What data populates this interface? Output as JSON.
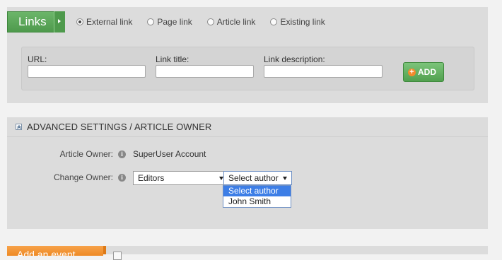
{
  "links": {
    "button_label": "Links",
    "radios": [
      {
        "label": "External link",
        "checked": true
      },
      {
        "label": "Page link",
        "checked": false
      },
      {
        "label": "Article link",
        "checked": false
      },
      {
        "label": "Existing link",
        "checked": false
      }
    ],
    "fields": {
      "url_label": "URL:",
      "url_value": "",
      "title_label": "Link title:",
      "title_value": "",
      "description_label": "Link description:",
      "description_value": ""
    },
    "add_label": "ADD"
  },
  "advanced": {
    "title": "ADVANCED SETTINGS / ARTICLE OWNER",
    "article_owner_label": "Article Owner:",
    "article_owner_value": "SuperUser Account",
    "change_owner_label": "Change Owner:",
    "group_select_value": "Editors",
    "author_select_value": "Select author",
    "author_options": [
      "Select author",
      "John Smith"
    ]
  },
  "bottom": {
    "add_event_label": "Add an event"
  },
  "icons": {
    "info": "info-icon",
    "collapse": "collapse-up-icon",
    "add": "plus-circle-icon"
  },
  "colors": {
    "green_button": "#51a04f",
    "orange_button": "#ee8a25",
    "dropdown_highlight": "#3d7ee6",
    "panel_bg": "#dcdcdc"
  }
}
